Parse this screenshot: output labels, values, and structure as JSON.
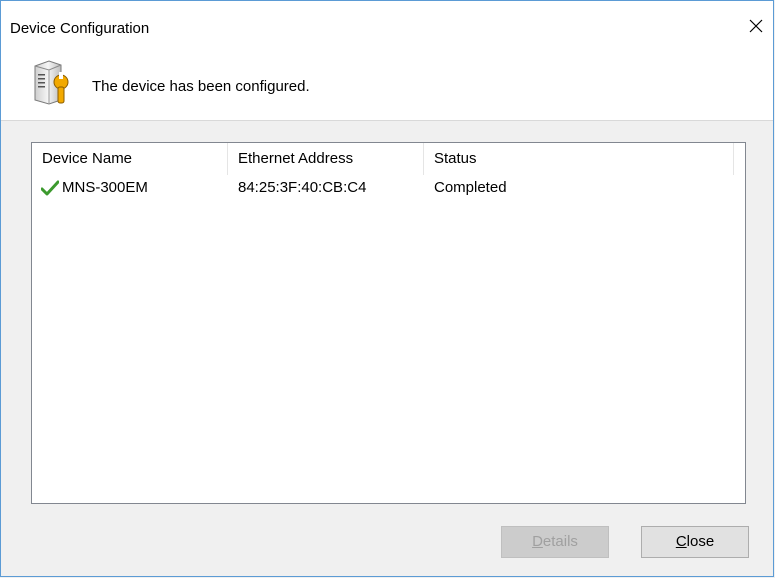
{
  "window": {
    "title": "Device Configuration",
    "close_label": "✕"
  },
  "message": "The device has been configured.",
  "table": {
    "columns": [
      "Device Name",
      "Ethernet Address",
      "Status"
    ],
    "rows": [
      {
        "device_name": "MNS-300EM",
        "ethernet_address": "84:25:3F:40:CB:C4",
        "status": "Completed",
        "status_icon": "check-icon"
      }
    ]
  },
  "buttons": {
    "details": {
      "mnemonic": "D",
      "rest": "etails",
      "enabled": false
    },
    "close": {
      "mnemonic": "C",
      "rest": "lose",
      "enabled": true
    }
  },
  "colors": {
    "check": "#3c9a2e",
    "window_border": "#5b9bd5"
  }
}
